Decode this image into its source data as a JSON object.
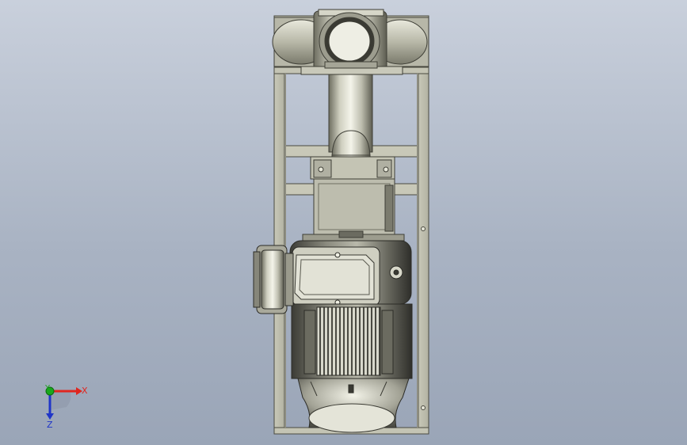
{
  "viewport": {
    "background_top": "#c9d0dc",
    "background_bottom": "#9aa5b7",
    "model": "vertical-pump-motor-assembly",
    "view": "front"
  },
  "triad": {
    "x_label": "X",
    "y_label": "Y",
    "z_label": "Z",
    "x_color": "#e0261f",
    "y_color": "#19a81c",
    "z_color": "#1f35c8"
  }
}
